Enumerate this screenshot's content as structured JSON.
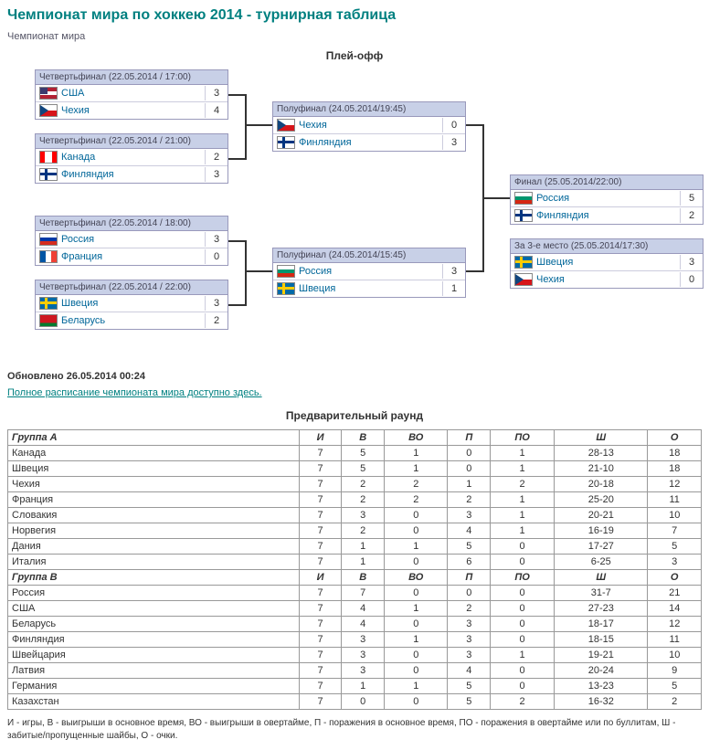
{
  "title": "Чемпионат мира по хоккею 2014 - турнирная таблица",
  "subtitle": "Чемпионат мира",
  "playoff_title": "Плей-офф",
  "updated": "Обновлено 26.05.2014 00:24",
  "schedule_link": "Полное расписание чемпионата мира доступно здесь.",
  "prelim_title": "Предварительный раунд",
  "matches": {
    "qf1": {
      "hdr": "Четвертьфинал (22.05.2014 / 17:00)",
      "t1": "США",
      "s1": "3",
      "t2": "Чехия",
      "s2": "4"
    },
    "qf2": {
      "hdr": "Четвертьфинал (22.05.2014 / 21:00)",
      "t1": "Канада",
      "s1": "2",
      "t2": "Финляндия",
      "s2": "3"
    },
    "qf3": {
      "hdr": "Четвертьфинал (22.05.2014 / 18:00)",
      "t1": "Россия",
      "s1": "3",
      "t2": "Франция",
      "s2": "0"
    },
    "qf4": {
      "hdr": "Четвертьфинал (22.05.2014 / 22:00)",
      "t1": "Швеция",
      "s1": "3",
      "t2": "Беларусь",
      "s2": "2"
    },
    "sf1": {
      "hdr": "Полуфинал (24.05.2014/19:45)",
      "t1": "Чехия",
      "s1": "0",
      "t2": "Финляндия",
      "s2": "3"
    },
    "sf2": {
      "hdr": "Полуфинал (24.05.2014/15:45)",
      "t1": "Россия",
      "s1": "3",
      "t2": "Швеция",
      "s2": "1"
    },
    "final": {
      "hdr": "Финал (25.05.2014/22:00)",
      "t1": "Россия",
      "s1": "5",
      "t2": "Финляндия",
      "s2": "2"
    },
    "third": {
      "hdr": "За 3-е место (25.05.2014/17:30)",
      "t1": "Швеция",
      "s1": "3",
      "t2": "Чехия",
      "s2": "0"
    }
  },
  "cols": {
    "i": "И",
    "v": "В",
    "vo": "ВО",
    "p": "П",
    "po": "ПО",
    "sh": "Ш",
    "o": "О"
  },
  "groupA_label": "Группа A",
  "groupB_label": "Группа B",
  "groupA": [
    {
      "team": "Канада",
      "i": "7",
      "v": "5",
      "vo": "1",
      "p": "0",
      "po": "1",
      "sh": "28-13",
      "o": "18"
    },
    {
      "team": "Швеция",
      "i": "7",
      "v": "5",
      "vo": "1",
      "p": "0",
      "po": "1",
      "sh": "21-10",
      "o": "18"
    },
    {
      "team": "Чехия",
      "i": "7",
      "v": "2",
      "vo": "2",
      "p": "1",
      "po": "2",
      "sh": "20-18",
      "o": "12"
    },
    {
      "team": "Франция",
      "i": "7",
      "v": "2",
      "vo": "2",
      "p": "2",
      "po": "1",
      "sh": "25-20",
      "o": "11"
    },
    {
      "team": "Словакия",
      "i": "7",
      "v": "3",
      "vo": "0",
      "p": "3",
      "po": "1",
      "sh": "20-21",
      "o": "10"
    },
    {
      "team": "Норвегия",
      "i": "7",
      "v": "2",
      "vo": "0",
      "p": "4",
      "po": "1",
      "sh": "16-19",
      "o": "7"
    },
    {
      "team": "Дания",
      "i": "7",
      "v": "1",
      "vo": "1",
      "p": "5",
      "po": "0",
      "sh": "17-27",
      "o": "5"
    },
    {
      "team": "Италия",
      "i": "7",
      "v": "1",
      "vo": "0",
      "p": "6",
      "po": "0",
      "sh": "6-25",
      "o": "3"
    }
  ],
  "groupB": [
    {
      "team": "Россия",
      "i": "7",
      "v": "7",
      "vo": "0",
      "p": "0",
      "po": "0",
      "sh": "31-7",
      "o": "21"
    },
    {
      "team": "США",
      "i": "7",
      "v": "4",
      "vo": "1",
      "p": "2",
      "po": "0",
      "sh": "27-23",
      "o": "14"
    },
    {
      "team": "Беларусь",
      "i": "7",
      "v": "4",
      "vo": "0",
      "p": "3",
      "po": "0",
      "sh": "18-17",
      "o": "12"
    },
    {
      "team": "Финляндия",
      "i": "7",
      "v": "3",
      "vo": "1",
      "p": "3",
      "po": "0",
      "sh": "18-15",
      "o": "11"
    },
    {
      "team": "Швейцария",
      "i": "7",
      "v": "3",
      "vo": "0",
      "p": "3",
      "po": "1",
      "sh": "19-21",
      "o": "10"
    },
    {
      "team": "Латвия",
      "i": "7",
      "v": "3",
      "vo": "0",
      "p": "4",
      "po": "0",
      "sh": "20-24",
      "o": "9"
    },
    {
      "team": "Германия",
      "i": "7",
      "v": "1",
      "vo": "1",
      "p": "5",
      "po": "0",
      "sh": "13-23",
      "o": "5"
    },
    {
      "team": "Казахстан",
      "i": "7",
      "v": "0",
      "vo": "0",
      "p": "5",
      "po": "2",
      "sh": "16-32",
      "o": "2"
    }
  ],
  "legend": "И - игры, В - выигрыши в основное время, ВО - выигрыши в овертайме, П - поражения в основное время, ПО - поражения в овертайме или по буллитам, Ш - забитые/пропущенные шайбы, О - очки."
}
